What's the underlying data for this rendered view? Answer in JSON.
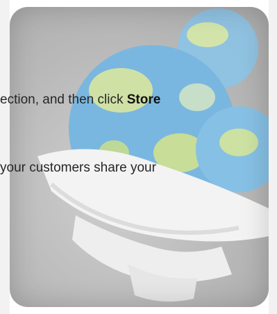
{
  "instructions": {
    "line1_prefix": "ection, and then click ",
    "line1_strong": "Store",
    "line2": "your customers share your"
  },
  "illustration": {
    "icon": "globe-in-shopping-bag-icon",
    "colors": {
      "card_bg": "#b9b9b9",
      "globe_blue": "#79b6df",
      "globe_green": "#d7e48a",
      "bag_white": "#f4f4f4"
    }
  }
}
